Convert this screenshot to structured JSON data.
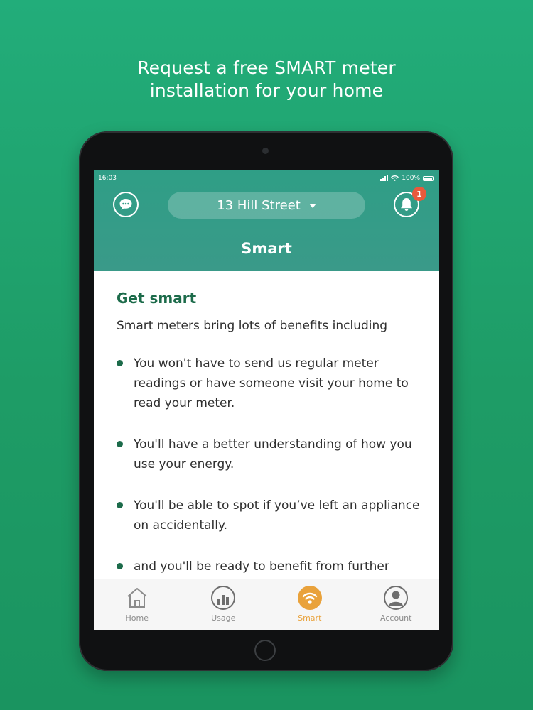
{
  "promo": {
    "line1": "Request a free SMART meter",
    "line2": "installation for your home"
  },
  "status_bar": {
    "time": "16:03",
    "battery": "100%"
  },
  "header": {
    "address": "13 Hill Street",
    "title": "Smart",
    "notification_count": "1",
    "chat_icon": "chat-bubble-icon",
    "bell_icon": "bell-icon"
  },
  "content": {
    "heading": "Get smart",
    "intro": "Smart meters bring lots of benefits including",
    "benefits": [
      "You won't have to send us regular meter readings or have someone visit your home to read your meter.",
      "You'll have a better understanding of how you use your energy.",
      "You'll be able to spot if you’ve left an appliance on accidentally.",
      "and you'll be ready to benefit from further"
    ]
  },
  "tabs": [
    {
      "label": "Home",
      "icon": "home-icon"
    },
    {
      "label": "Usage",
      "icon": "usage-chart-icon"
    },
    {
      "label": "Smart",
      "icon": "smart-meter-icon"
    },
    {
      "label": "Account",
      "icon": "account-icon"
    }
  ],
  "active_tab": "Smart",
  "colors": {
    "background": "#1e9c66",
    "header": "#2f9e86",
    "heading": "#1c6b4a",
    "active_tab": "#e9a23b",
    "inactive_tab": "#8b8b8b",
    "badge": "#e8593c"
  }
}
